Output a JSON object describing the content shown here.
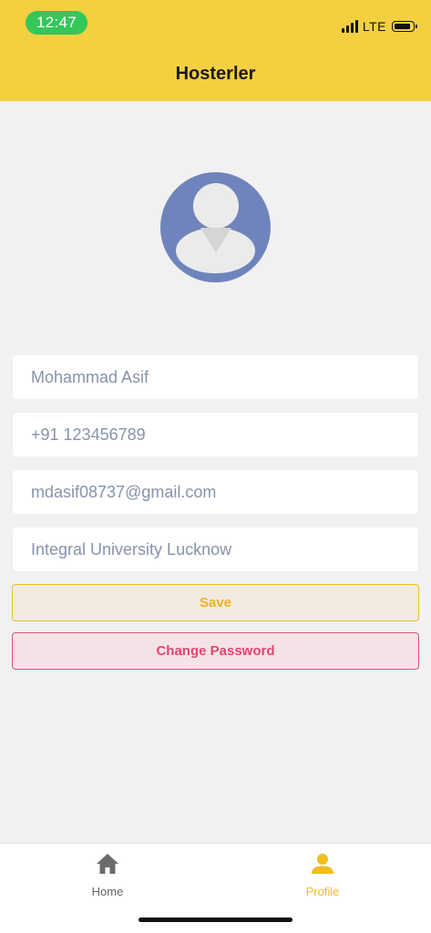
{
  "status_bar": {
    "time": "12:47",
    "network": "LTE"
  },
  "header": {
    "title": "Hosterler"
  },
  "profile": {
    "name": "Mohammad Asif",
    "phone": "+91 123456789",
    "email": "mdasif08737@gmail.com",
    "college": "Integral University Lucknow"
  },
  "actions": {
    "save_label": "Save",
    "change_password_label": "Change Password"
  },
  "tabbar": {
    "items": [
      {
        "label": "Home",
        "icon": "home-icon",
        "active": false
      },
      {
        "label": "Profile",
        "icon": "person-icon",
        "active": true
      }
    ]
  },
  "colors": {
    "brand_yellow": "#f4cf40",
    "save_accent": "#efb320",
    "danger_accent": "#e34573",
    "avatar_bg": "#6f84bd"
  }
}
